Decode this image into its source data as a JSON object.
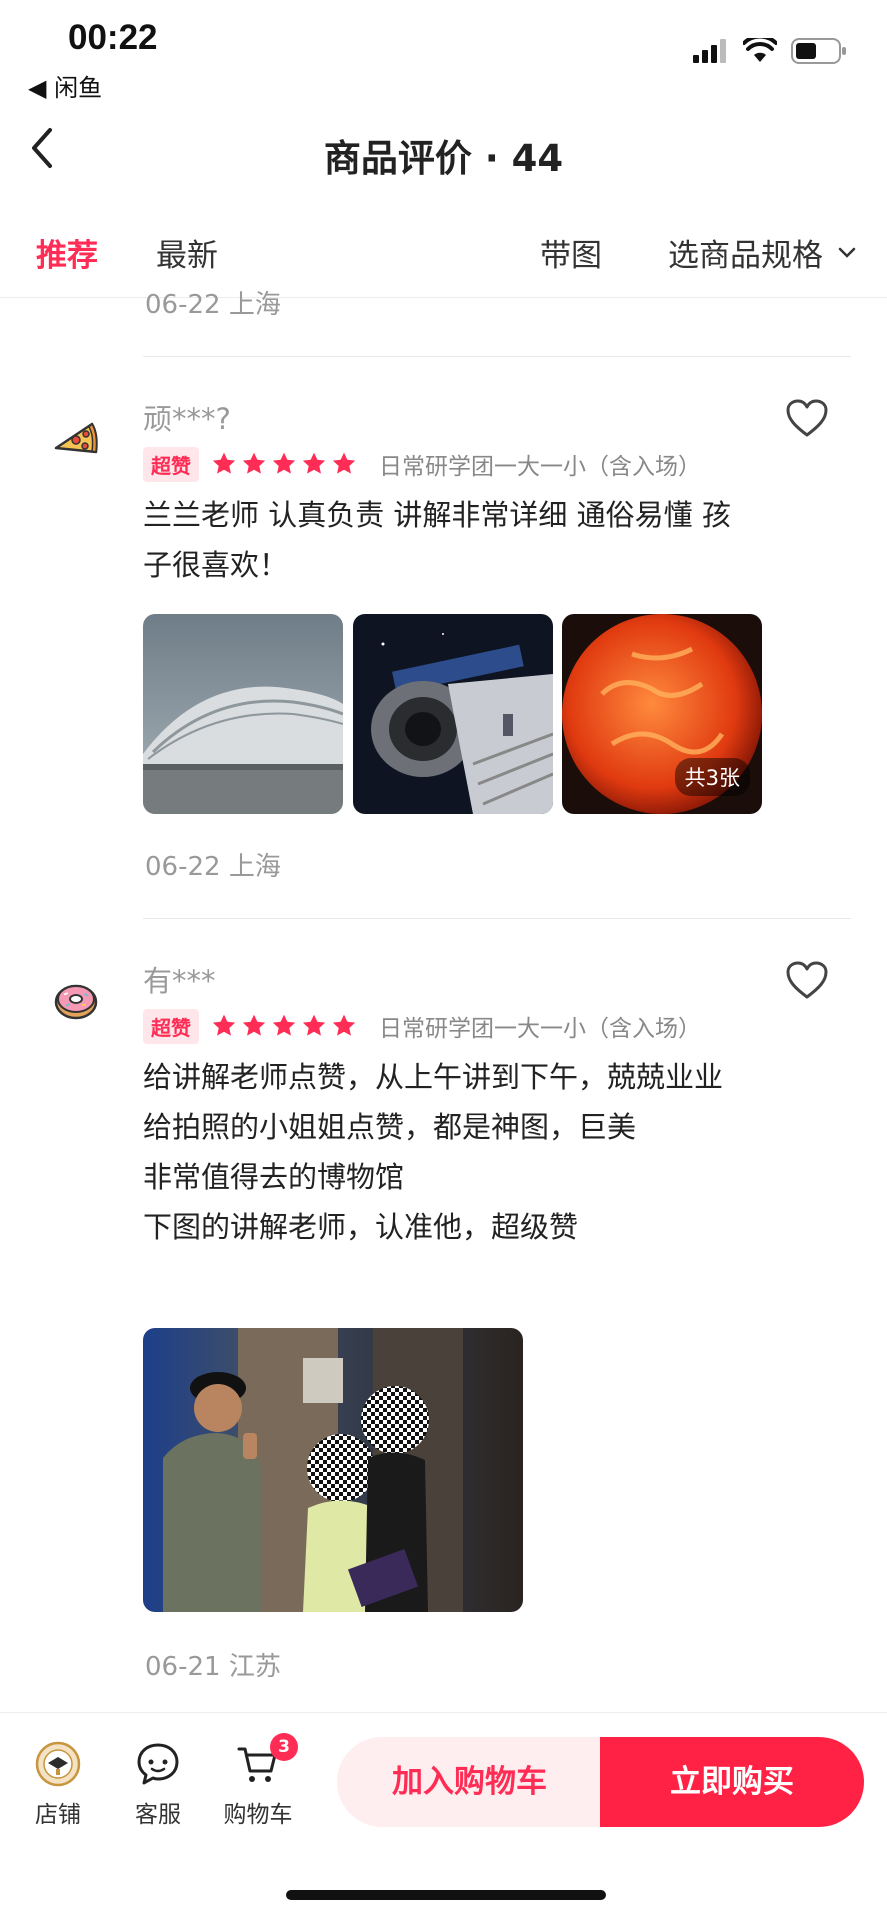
{
  "status": {
    "time": "00:22",
    "back_app": "◀ 闲鱼"
  },
  "nav": {
    "title": "商品评价 · 44"
  },
  "filters": {
    "recommend": "推荐",
    "latest": "最新",
    "with_photos": "带图",
    "spec_select": "选商品规格"
  },
  "partial_review": {
    "meta": "06-22  上海"
  },
  "reviews": [
    {
      "username": "顽***?",
      "badge": "超赞",
      "spec": "日常研学团一大一小（含入场）",
      "text": "兰兰老师 认真负责 讲解非常详细 通俗易懂 孩子很喜欢！",
      "photo_count": "共3张",
      "meta": "06-22  上海"
    },
    {
      "username": "有***",
      "badge": "超赞",
      "spec": "日常研学团一大一小（含入场）",
      "text": "给讲解老师点赞，从上午讲到下午，兢兢业业\n给拍照的小姐姐点赞，都是神图，巨美\n非常值得去的博物馆\n下图的讲解老师，认准他，超级赞",
      "meta": "06-21  江苏"
    }
  ],
  "bottom": {
    "shop": "店铺",
    "service": "客服",
    "cart": "购物车",
    "cart_count": "3",
    "add_cart": "加入购物车",
    "buy_now": "立即购买"
  },
  "colors": {
    "accent": "#ff2d55",
    "buy": "#ff2244",
    "cart_bg": "#ffeef0"
  }
}
